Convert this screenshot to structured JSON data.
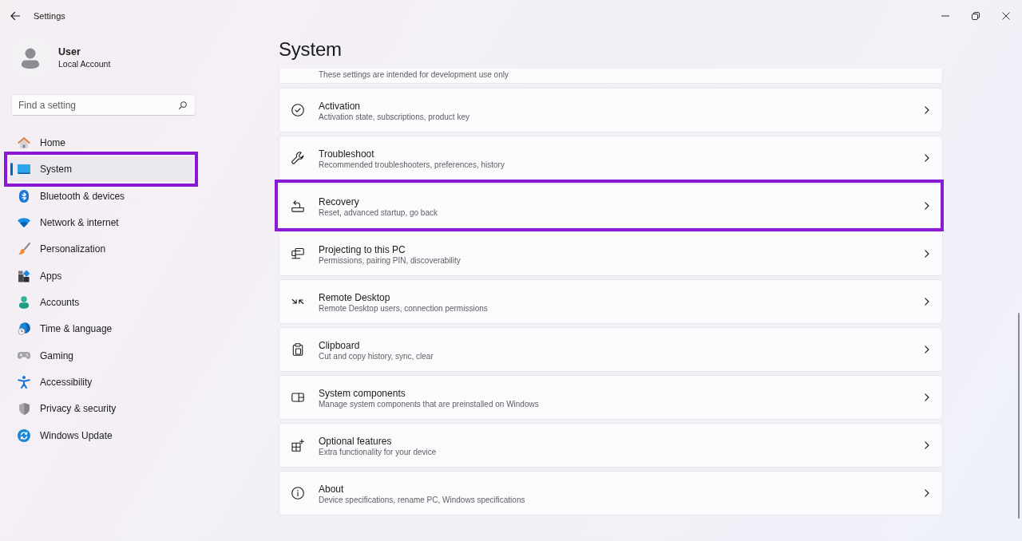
{
  "window": {
    "title": "Settings"
  },
  "account": {
    "name": "User",
    "type": "Local Account"
  },
  "search": {
    "placeholder": "Find a setting"
  },
  "sidebar": {
    "items": [
      {
        "label": "Home",
        "selected": false,
        "highlighted": false
      },
      {
        "label": "System",
        "selected": true,
        "highlighted": true
      },
      {
        "label": "Bluetooth & devices",
        "selected": false,
        "highlighted": false
      },
      {
        "label": "Network & internet",
        "selected": false,
        "highlighted": false
      },
      {
        "label": "Personalization",
        "selected": false,
        "highlighted": false
      },
      {
        "label": "Apps",
        "selected": false,
        "highlighted": false
      },
      {
        "label": "Accounts",
        "selected": false,
        "highlighted": false
      },
      {
        "label": "Time & language",
        "selected": false,
        "highlighted": false
      },
      {
        "label": "Gaming",
        "selected": false,
        "highlighted": false
      },
      {
        "label": "Accessibility",
        "selected": false,
        "highlighted": false
      },
      {
        "label": "Privacy & security",
        "selected": false,
        "highlighted": false
      },
      {
        "label": "Windows Update",
        "selected": false,
        "highlighted": false
      }
    ]
  },
  "page": {
    "title": "System",
    "partial_card": {
      "description": "These settings are intended for development use only"
    },
    "rows": [
      {
        "title": "Activation",
        "description": "Activation state, subscriptions, product key",
        "highlighted": false
      },
      {
        "title": "Troubleshoot",
        "description": "Recommended troubleshooters, preferences, history",
        "highlighted": false
      },
      {
        "title": "Recovery",
        "description": "Reset, advanced startup, go back",
        "highlighted": true
      },
      {
        "title": "Projecting to this PC",
        "description": "Permissions, pairing PIN, discoverability",
        "highlighted": false
      },
      {
        "title": "Remote Desktop",
        "description": "Remote Desktop users, connection permissions",
        "highlighted": false
      },
      {
        "title": "Clipboard",
        "description": "Cut and copy history, sync, clear",
        "highlighted": false
      },
      {
        "title": "System components",
        "description": "Manage system components that are preinstalled on Windows",
        "highlighted": false
      },
      {
        "title": "Optional features",
        "description": "Extra functionality for your device",
        "highlighted": false
      },
      {
        "title": "About",
        "description": "Device specifications, rename PC, Windows specifications",
        "highlighted": false
      }
    ]
  }
}
